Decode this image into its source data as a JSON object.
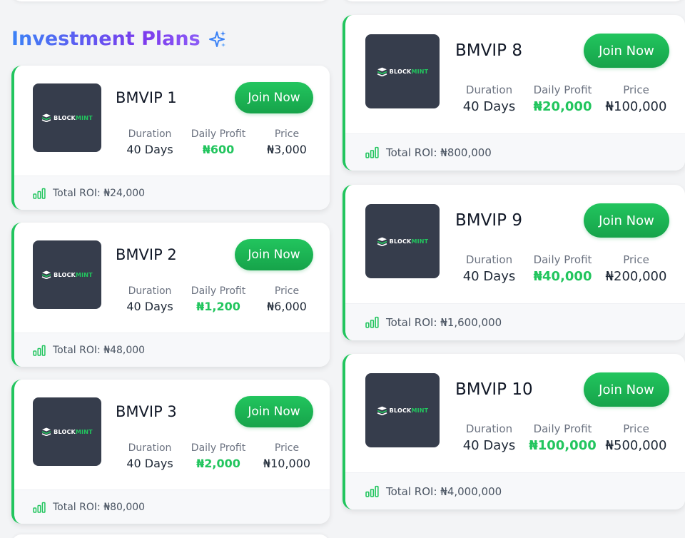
{
  "heading": {
    "title": "Investment Plans",
    "icon": "sparkles-icon"
  },
  "brand": {
    "logo_main": "BLOCK",
    "logo_accent": "MINT"
  },
  "labels": {
    "duration": "Duration",
    "daily_profit": "Daily Profit",
    "price": "Price"
  },
  "colors": {
    "accent": "#22c55e",
    "heading_start": "#3b82f6",
    "heading_end": "#8b5cf6",
    "thumb_bg": "#363d4c"
  },
  "left_plans": [
    {
      "name": "BMVIP 1",
      "join_label": "Join Now",
      "duration": "40 Days",
      "daily_profit": "₦600",
      "price": "₦3,000",
      "total_roi": "Total ROI: ₦24,000"
    },
    {
      "name": "BMVIP 2",
      "join_label": "Join Now",
      "duration": "40 Days",
      "daily_profit": "₦1,200",
      "price": "₦6,000",
      "total_roi": "Total ROI: ₦48,000"
    },
    {
      "name": "BMVIP 3",
      "join_label": "Join Now",
      "duration": "40 Days",
      "daily_profit": "₦2,000",
      "price": "₦10,000",
      "total_roi": "Total ROI: ₦80,000"
    }
  ],
  "right_plans": [
    {
      "name": "BMVIP 8",
      "join_label": "Join Now",
      "duration": "40 Days",
      "daily_profit": "₦20,000",
      "price": "₦100,000",
      "total_roi": "Total ROI: ₦800,000"
    },
    {
      "name": "BMVIP 9",
      "join_label": "Join Now",
      "duration": "40 Days",
      "daily_profit": "₦40,000",
      "price": "₦200,000",
      "total_roi": "Total ROI: ₦1,600,000"
    },
    {
      "name": "BMVIP 10",
      "join_label": "Join Now",
      "duration": "40 Days",
      "daily_profit": "₦100,000",
      "price": "₦500,000",
      "total_roi": "Total ROI: ₦4,000,000"
    }
  ]
}
